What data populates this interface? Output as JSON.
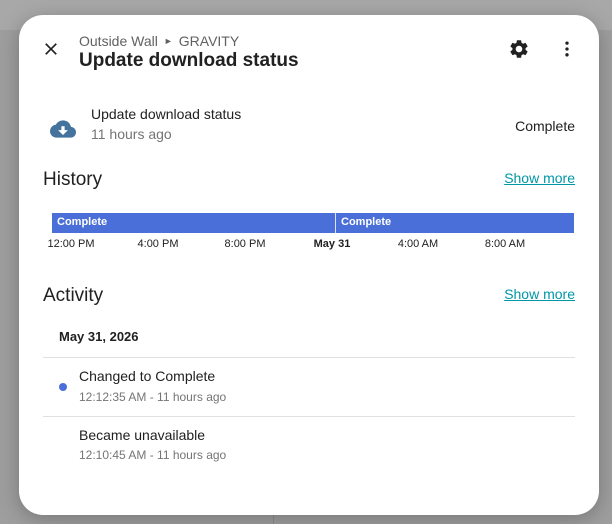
{
  "breadcrumb": {
    "area": "Outside Wall",
    "device": "GRAVITY"
  },
  "dialog": {
    "title": "Update download status"
  },
  "icons": {
    "close": "close-icon",
    "settings": "gear-icon",
    "more": "more-vert-icon",
    "entity": "cloud-download-icon"
  },
  "entity": {
    "name": "Update download status",
    "last_changed": "11 hours ago",
    "state": "Complete"
  },
  "history": {
    "title": "History",
    "show_more": "Show more",
    "segments": [
      {
        "label": "Complete"
      },
      {
        "label": "Complete"
      }
    ],
    "ticks": [
      "12:00 PM",
      "4:00 PM",
      "8:00 PM",
      "May 31",
      "4:00 AM",
      "8:00 AM"
    ],
    "bar_color": "#4a6fd8"
  },
  "activity": {
    "title": "Activity",
    "show_more": "Show more",
    "date": "May 31, 2026",
    "items": [
      {
        "title": "Changed to Complete",
        "subtitle": "12:12:35 AM - 11 hours ago"
      },
      {
        "title": "Became unavailable",
        "subtitle": "12:10:45 AM - 11 hours ago"
      }
    ]
  },
  "colors": {
    "accent": "#4a6fd8",
    "link": "#0097a7",
    "entity_icon": "#44739e"
  }
}
